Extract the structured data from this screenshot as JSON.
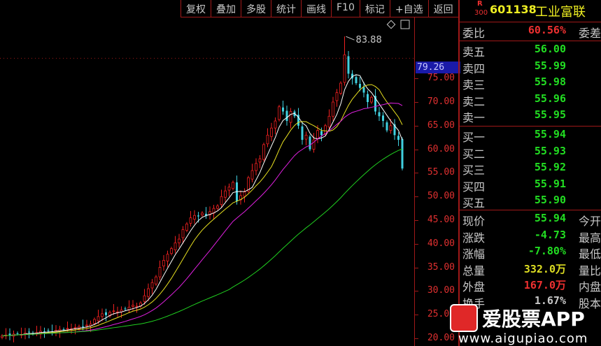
{
  "toolbar": [
    "复权",
    "叠加",
    "多股",
    "统计",
    "画线",
    "F10",
    "标记",
    "+自选",
    "返回"
  ],
  "stock": {
    "badge_top": "R",
    "badge_bottom": "300",
    "code": "601138",
    "name": "工业富联"
  },
  "weibi": {
    "label": "委比",
    "value": "60.56%",
    "right": "委差"
  },
  "asks": [
    {
      "label": "卖五",
      "price": "56.00"
    },
    {
      "label": "卖四",
      "price": "55.99"
    },
    {
      "label": "卖三",
      "price": "55.98"
    },
    {
      "label": "卖二",
      "price": "55.96"
    },
    {
      "label": "卖一",
      "price": "55.95"
    }
  ],
  "bids": [
    {
      "label": "买一",
      "price": "55.94"
    },
    {
      "label": "买二",
      "price": "55.93"
    },
    {
      "label": "买三",
      "price": "55.92"
    },
    {
      "label": "买四",
      "price": "55.91"
    },
    {
      "label": "买五",
      "price": "55.90"
    }
  ],
  "stats": [
    {
      "label": "现价",
      "value": "55.94",
      "right": "今开",
      "color": "g"
    },
    {
      "label": "涨跌",
      "value": "-4.73",
      "right": "最高",
      "color": "g"
    },
    {
      "label": "涨幅",
      "value": "-7.80%",
      "right": "最低",
      "color": "g"
    },
    {
      "label": "总量",
      "value": "332.0万",
      "right": "量比",
      "color": "y"
    },
    {
      "label": "外盘",
      "value": "167.0万",
      "right": "内盘",
      "color": "rd"
    },
    {
      "label": "换手",
      "value": "1.67%",
      "right": "股本",
      "color": ""
    }
  ],
  "watermark": {
    "text": "爱股票APP",
    "url": "www.aigupiao.com"
  },
  "chart_data": {
    "type": "candlestick",
    "y_ticks": [
      75,
      70,
      65,
      60,
      55,
      50,
      45,
      40,
      35,
      30,
      25,
      20
    ],
    "y_tick_labels": [
      "75.00",
      "70.00",
      "65.00",
      "60.00",
      "55.00",
      "50.00",
      "45.00",
      "40.00",
      "35.00",
      "30.00",
      "25.00",
      "20.00"
    ],
    "ylim": [
      19.5,
      88
    ],
    "high_annotation": "83.88",
    "high_value": 83.88,
    "current_price_label": "79.26",
    "current_price": 79.26,
    "closes": [
      20.5,
      20.7,
      20.6,
      20.9,
      21.0,
      20.8,
      21.1,
      21.3,
      21.0,
      21.2,
      21.5,
      21.4,
      21.6,
      21.3,
      21.7,
      21.9,
      21.8,
      22.1,
      22.0,
      22.3,
      22.5,
      22.4,
      22.8,
      23.0,
      24.0,
      24.6,
      25.2,
      24.9,
      25.5,
      25.8,
      25.6,
      26.0,
      26.2,
      26.6,
      27.0,
      26.8,
      27.5,
      29.0,
      30.5,
      31.8,
      33.0,
      35.0,
      36.5,
      37.8,
      39.0,
      40.2,
      41.0,
      43.0,
      44.2,
      45.5,
      46.0,
      45.8,
      46.5,
      46.0,
      46.8,
      47.5,
      48.0,
      50.0,
      51.2,
      52.0,
      53.0,
      49.0,
      50.2,
      51.0,
      54.0,
      55.5,
      57.0,
      58.0,
      61.0,
      63.0,
      64.5,
      66.0,
      69.0,
      68.0,
      66.0,
      68.0,
      67.0,
      65.0,
      62.0,
      63.0,
      60.0,
      62.0,
      64.0,
      63.0,
      65.0,
      67.0,
      70.0,
      72.0,
      74.0,
      80.0,
      76.0,
      75.0,
      74.0,
      73.0,
      72.0,
      70.0,
      71.0,
      68.0,
      67.0,
      66.0,
      64.0,
      65.0,
      63.0,
      62.0,
      55.94
    ],
    "ma": [
      {
        "name": "MA5",
        "period": 5,
        "color": "#ffffff"
      },
      {
        "name": "MA10",
        "period": 10,
        "color": "#e8e020"
      },
      {
        "name": "MA20",
        "period": 20,
        "color": "#e020e0"
      },
      {
        "name": "MA60",
        "period": 60,
        "color": "#20d020"
      }
    ],
    "up_color": "#ee2020",
    "down_color": "#40d0e0"
  }
}
